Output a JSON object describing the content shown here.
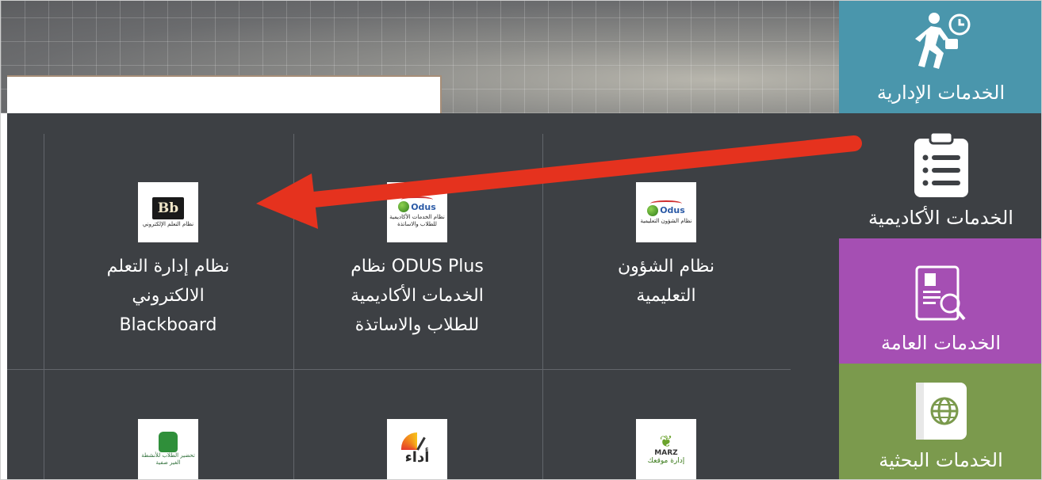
{
  "colors": {
    "admin": "#4a96ac",
    "academic": "#3d4044",
    "general": "#a54fb3",
    "research": "#7b9a4d",
    "grid_bg": "#3d4044",
    "arrow": "#e5321e"
  },
  "sidebar": {
    "items": [
      {
        "label": "الخدمات الإدارية",
        "icon": "running-businessman-clock-icon"
      },
      {
        "label": "الخدمات الأكاديمية",
        "icon": "clipboard-list-icon"
      },
      {
        "label": "الخدمات العامة",
        "icon": "profile-search-icon"
      },
      {
        "label": "الخدمات البحثية",
        "icon": "globe-book-icon"
      }
    ]
  },
  "tiles": [
    {
      "logo_bb": "Bb",
      "logo_caption": "نظام التعلم الإلكتروني",
      "lines": [
        "نظام إدارة التعلم",
        "الالكتروني",
        "Blackboard"
      ]
    },
    {
      "logo_odus": "Odus",
      "logo_caption": "نظام الخدمات الأكاديمية للطلاب والاساتذة",
      "lines": [
        "ODUS Plus نظام",
        "الخدمات الأكاديمية",
        "للطلاب والاساتذة"
      ]
    },
    {
      "logo_odus": "Odus",
      "logo_caption": "نظام الشؤون التعليمية",
      "lines": [
        "نظام الشؤون",
        "التعليمية"
      ]
    },
    {
      "logo_caption": "تحضير الطلاب للأنشطة الغير صفية"
    },
    {
      "logo_text": "أداء"
    },
    {
      "logo_marz": "MARZ",
      "logo_caption": "إدارة موقعك"
    }
  ]
}
